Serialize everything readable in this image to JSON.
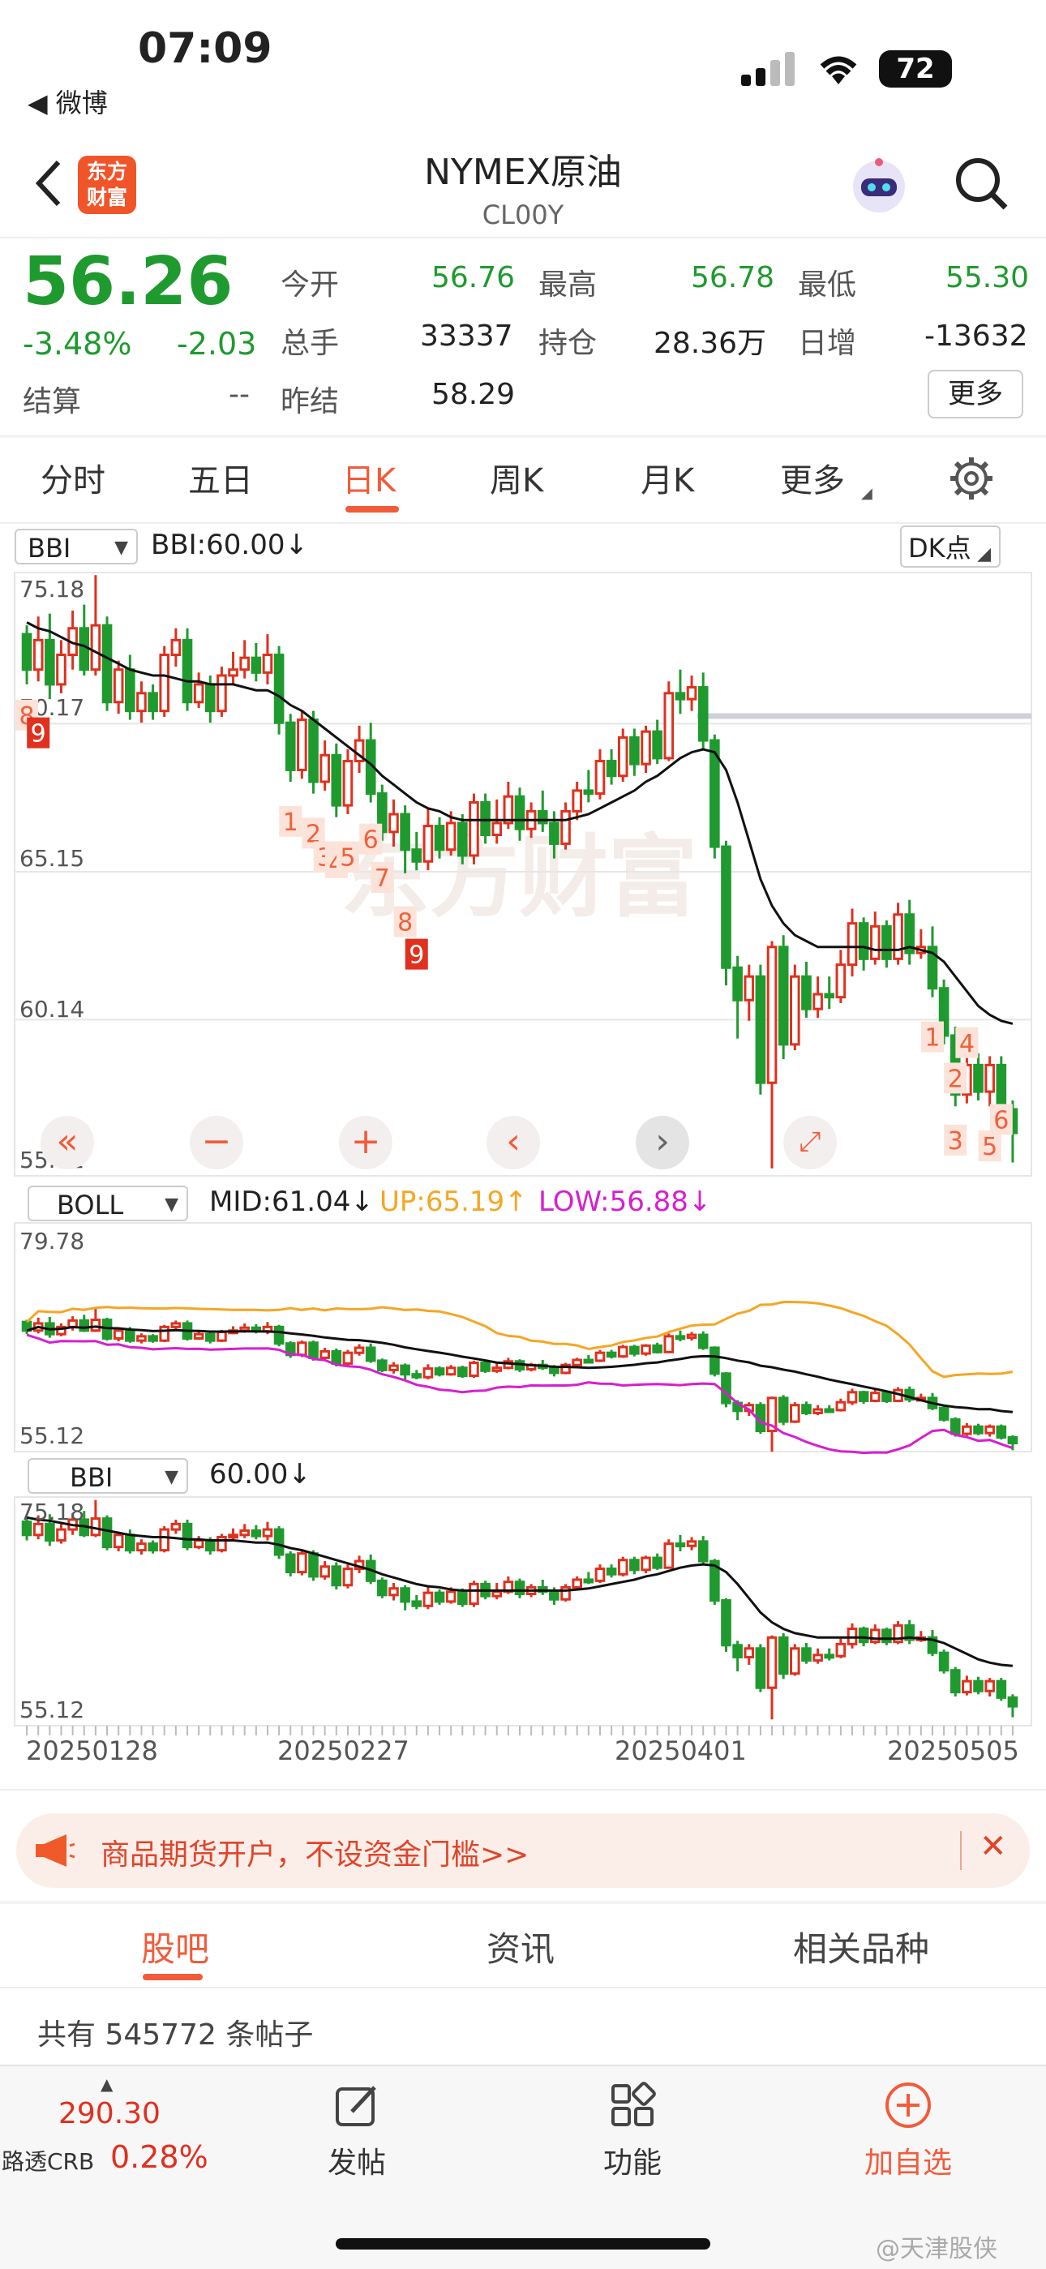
{
  "status_bar": {
    "time": "07:09",
    "back_app": "◀ 微博",
    "battery": "72"
  },
  "header": {
    "title": "NYMEX原油",
    "code": "CL00Y",
    "logo_line1": "东方",
    "logo_line2": "财富"
  },
  "quote": {
    "price": "56.26",
    "change_pct": "-3.48%",
    "change": "-2.03",
    "open_label": "今开",
    "open": "56.76",
    "high_label": "最高",
    "high": "56.78",
    "low_label": "最低",
    "low": "55.30",
    "volume_label": "总手",
    "volume": "33337",
    "position_label": "持仓",
    "position": "28.36万",
    "daily_inc_label": "日增",
    "daily_inc": "-13632",
    "settle_label": "结算",
    "settle": "--",
    "prev_settle_label": "昨结",
    "prev_settle": "58.29",
    "more_button": "更多"
  },
  "tabs": [
    {
      "label": "分时"
    },
    {
      "label": "五日"
    },
    {
      "label": "日K"
    },
    {
      "label": "周K"
    },
    {
      "label": "月K"
    },
    {
      "label": "更多"
    }
  ],
  "main_chart": {
    "indicator": "BBI",
    "indicator_value": "BBI:60.00↓",
    "dk_button": "DK点",
    "y_ticks": [
      "75.18",
      "70.17",
      "65.15",
      "60.14",
      "55.12"
    ],
    "watermark": "东方财富"
  },
  "boll_chart": {
    "indicator": "BOLL",
    "mid": "MID:61.04↓",
    "up": "UP:65.19↑",
    "low": "LOW:56.88↓",
    "y_ticks": [
      "79.78",
      "55.12"
    ]
  },
  "bbi_chart": {
    "indicator": "BBI",
    "value": "60.00↓",
    "y_ticks": [
      "75.18",
      "55.12"
    ]
  },
  "x_dates": [
    "20250128",
    "20250227",
    "20250401",
    "20250505"
  ],
  "banner": {
    "text": "商品期货开户，不设资金门槛>>"
  },
  "sub_tabs": [
    {
      "label": "股吧"
    },
    {
      "label": "资讯"
    },
    {
      "label": "相关品种"
    }
  ],
  "posts": {
    "count_text": "共有 545772 条帖子"
  },
  "bottom_bar": {
    "crb_value": "290.30",
    "crb_label": "路透CRB",
    "crb_pct": "0.28%",
    "post": "发帖",
    "function": "功能",
    "add": "加自选"
  },
  "watermark_corner": "@天津股侠",
  "colors": {
    "up": "#e0301e",
    "down": "#1f9a2f",
    "accent": "#f25b3a",
    "boll_up": "#f5a623",
    "boll_low": "#d61fd0"
  },
  "chart_data": {
    "type": "candlestick",
    "ylim": [
      55.12,
      75.18
    ],
    "candles": [
      [
        73.2,
        72.0,
        73.5,
        71.5
      ],
      [
        72.0,
        73.0,
        73.8,
        71.6
      ],
      [
        73.0,
        71.5,
        73.9,
        71.0
      ],
      [
        71.5,
        72.5,
        73.0,
        71.2
      ],
      [
        72.5,
        73.4,
        74.0,
        72.0
      ],
      [
        73.4,
        72.0,
        74.2,
        71.8
      ],
      [
        72.0,
        73.5,
        75.2,
        71.8
      ],
      [
        73.5,
        70.9,
        73.8,
        70.6
      ],
      [
        70.9,
        72.0,
        72.3,
        70.5
      ],
      [
        72.0,
        70.6,
        72.5,
        70.3
      ],
      [
        70.6,
        71.2,
        71.6,
        70.2
      ],
      [
        71.2,
        70.6,
        71.5,
        70.3
      ],
      [
        70.6,
        72.5,
        72.8,
        70.4
      ],
      [
        72.5,
        73.0,
        73.4,
        72.1
      ],
      [
        73.0,
        70.9,
        73.4,
        70.6
      ],
      [
        70.9,
        71.5,
        71.9,
        70.7
      ],
      [
        71.5,
        70.6,
        71.8,
        70.2
      ],
      [
        70.6,
        71.8,
        72.1,
        70.4
      ],
      [
        71.8,
        72.0,
        72.6,
        71.5
      ],
      [
        72.0,
        72.4,
        73.0,
        71.7
      ],
      [
        72.4,
        71.9,
        72.9,
        71.6
      ],
      [
        71.9,
        72.5,
        73.2,
        71.5
      ],
      [
        72.5,
        70.2,
        72.8,
        69.8
      ],
      [
        70.2,
        68.6,
        70.5,
        68.2
      ],
      [
        68.6,
        70.3,
        70.6,
        68.3
      ],
      [
        70.3,
        68.2,
        70.6,
        67.8
      ],
      [
        68.2,
        69.1,
        69.6,
        67.9
      ],
      [
        69.1,
        67.4,
        69.5,
        67.0
      ],
      [
        67.4,
        68.9,
        69.3,
        67.1
      ],
      [
        68.9,
        69.6,
        70.1,
        68.5
      ],
      [
        69.6,
        67.8,
        70.2,
        67.5
      ],
      [
        67.8,
        66.5,
        68.1,
        66.2
      ],
      [
        66.5,
        67.1,
        67.6,
        66.0
      ],
      [
        67.1,
        65.9,
        67.4,
        65.1
      ],
      [
        65.9,
        65.5,
        66.5,
        65.2
      ],
      [
        65.5,
        66.7,
        67.3,
        65.2
      ],
      [
        66.7,
        65.9,
        67.0,
        65.6
      ],
      [
        65.9,
        66.8,
        67.2,
        65.7
      ],
      [
        66.8,
        65.7,
        67.1,
        65.4
      ],
      [
        65.7,
        67.5,
        67.8,
        65.4
      ],
      [
        67.5,
        66.4,
        67.8,
        66.1
      ],
      [
        66.4,
        66.8,
        67.6,
        66.1
      ],
      [
        66.8,
        67.7,
        68.2,
        66.6
      ],
      [
        67.7,
        66.6,
        68.0,
        66.2
      ],
      [
        66.6,
        67.2,
        67.5,
        66.3
      ],
      [
        67.2,
        66.8,
        67.9,
        66.5
      ],
      [
        66.8,
        66.1,
        67.2,
        65.6
      ],
      [
        66.1,
        67.2,
        67.5,
        65.9
      ],
      [
        67.2,
        67.9,
        68.2,
        66.9
      ],
      [
        67.9,
        67.8,
        68.6,
        67.5
      ],
      [
        67.8,
        68.9,
        69.3,
        67.6
      ],
      [
        68.9,
        68.4,
        69.3,
        68.1
      ],
      [
        68.4,
        69.7,
        70.0,
        68.2
      ],
      [
        69.7,
        68.8,
        70.0,
        68.4
      ],
      [
        68.8,
        69.9,
        70.1,
        68.5
      ],
      [
        69.9,
        69.0,
        70.3,
        68.8
      ],
      [
        69.0,
        71.2,
        71.6,
        68.9
      ],
      [
        71.2,
        71.0,
        72.0,
        70.5
      ],
      [
        71.0,
        71.4,
        71.8,
        70.6
      ],
      [
        71.4,
        69.6,
        71.9,
        69.3
      ],
      [
        69.6,
        66.0,
        69.8,
        65.6
      ],
      [
        66.0,
        61.9,
        66.2,
        61.3
      ],
      [
        61.9,
        60.8,
        62.3,
        59.5
      ],
      [
        60.8,
        61.6,
        62.0,
        60.1
      ],
      [
        61.6,
        58.0,
        62.0,
        57.6
      ],
      [
        58.0,
        62.6,
        62.8,
        55.1
      ],
      [
        62.6,
        59.3,
        63.0,
        58.8
      ],
      [
        59.3,
        61.6,
        62.0,
        59.1
      ],
      [
        61.6,
        60.5,
        62.1,
        60.2
      ],
      [
        60.5,
        61.0,
        61.6,
        60.2
      ],
      [
        61.0,
        60.9,
        61.6,
        60.5
      ],
      [
        60.9,
        62.0,
        62.5,
        60.7
      ],
      [
        62.0,
        63.4,
        63.9,
        61.6
      ],
      [
        63.4,
        62.2,
        63.6,
        61.8
      ],
      [
        62.2,
        63.3,
        63.8,
        62.0
      ],
      [
        63.3,
        62.2,
        63.5,
        61.9
      ],
      [
        62.2,
        63.7,
        64.1,
        62.0
      ],
      [
        63.7,
        62.4,
        64.2,
        62.0
      ],
      [
        62.4,
        62.6,
        63.2,
        62.2
      ],
      [
        62.6,
        61.2,
        63.3,
        60.9
      ],
      [
        61.2,
        59.6,
        61.5,
        59.3
      ],
      [
        59.6,
        57.6,
        59.9,
        57.2
      ],
      [
        57.6,
        58.6,
        59.1,
        57.3
      ],
      [
        58.6,
        57.7,
        59.0,
        57.4
      ],
      [
        57.7,
        58.6,
        58.9,
        57.2
      ],
      [
        58.6,
        57.1,
        58.9,
        56.8
      ],
      [
        57.1,
        56.3,
        57.4,
        55.3
      ]
    ],
    "bbi": [
      73.6,
      73.4,
      73.3,
      73.1,
      72.9,
      72.8,
      72.6,
      72.4,
      72.2,
      72.0,
      71.9,
      71.8,
      71.8,
      71.7,
      71.6,
      71.6,
      71.5,
      71.5,
      71.5,
      71.4,
      71.3,
      71.3,
      71.1,
      70.8,
      70.6,
      70.3,
      70.0,
      69.7,
      69.4,
      69.1,
      68.8,
      68.4,
      68.1,
      67.8,
      67.5,
      67.3,
      67.2,
      67.0,
      66.9,
      66.9,
      66.9,
      66.9,
      66.9,
      66.9,
      66.9,
      66.9,
      66.9,
      66.9,
      67.0,
      67.1,
      67.3,
      67.5,
      67.7,
      67.9,
      68.2,
      68.4,
      68.7,
      69.0,
      69.2,
      69.3,
      69.2,
      68.6,
      67.5,
      66.2,
      64.9,
      64.0,
      63.4,
      63.0,
      62.8,
      62.6,
      62.6,
      62.6,
      62.6,
      62.6,
      62.5,
      62.5,
      62.5,
      62.6,
      62.5,
      62.4,
      62.1,
      61.6,
      61.1,
      60.6,
      60.3,
      60.1,
      60.0
    ],
    "dk_numbers": [
      {
        "i": 0,
        "t": "8",
        "v": 71.2
      },
      {
        "i": 1,
        "t": "9",
        "v": 70.6,
        "box": true
      },
      {
        "i": 23,
        "t": "1",
        "v": 67.6
      },
      {
        "i": 25,
        "t": "2",
        "v": 67.2
      },
      {
        "i": 26,
        "t": "3",
        "v": 66.4
      },
      {
        "i": 27,
        "t": "4",
        "v": 66.2
      },
      {
        "i": 28,
        "t": "5",
        "v": 66.4
      },
      {
        "i": 30,
        "t": "6",
        "v": 67.0
      },
      {
        "i": 31,
        "t": "7",
        "v": 65.7
      },
      {
        "i": 33,
        "t": "8",
        "v": 64.2
      },
      {
        "i": 34,
        "t": "9",
        "v": 63.1,
        "box": true
      },
      {
        "i": 79,
        "t": "1",
        "v": 60.3
      },
      {
        "i": 81,
        "t": "2",
        "v": 58.9
      },
      {
        "i": 82,
        "t": "4",
        "v": 60.1
      },
      {
        "i": 81,
        "t": "3",
        "v": 56.8
      },
      {
        "i": 84,
        "t": "5",
        "v": 56.6
      },
      {
        "i": 85,
        "t": "6",
        "v": 57.5
      }
    ]
  }
}
